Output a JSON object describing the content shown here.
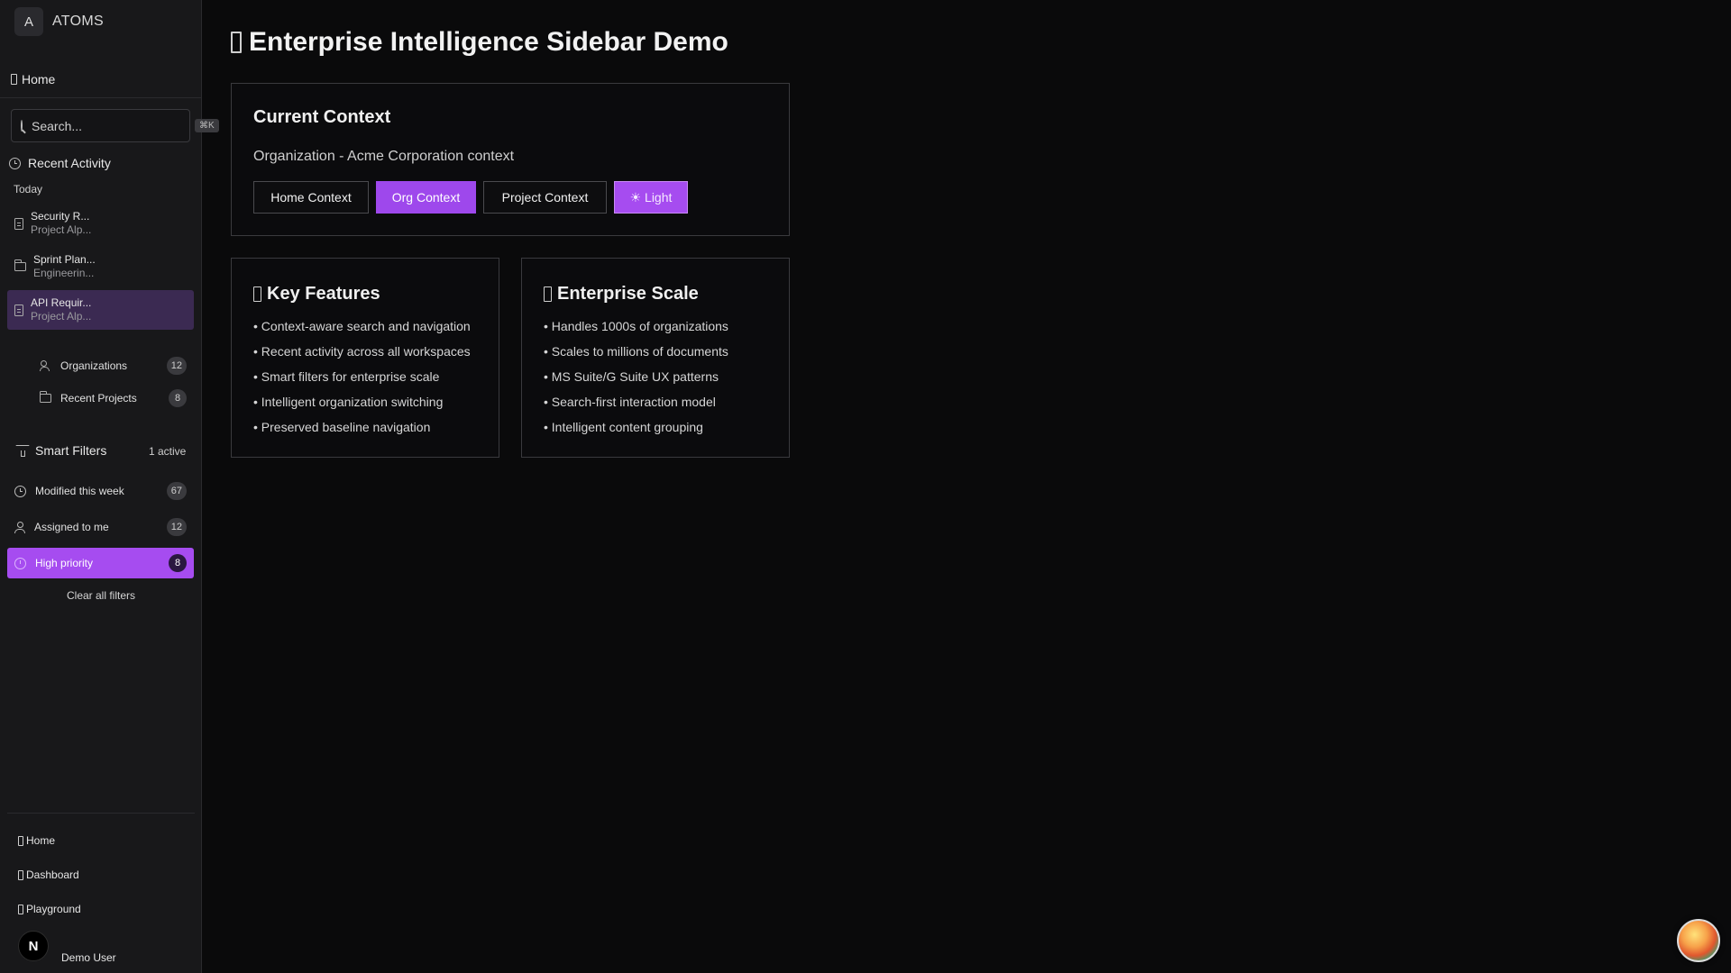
{
  "brand": {
    "initial": "A",
    "name": "ATOMS"
  },
  "nav_top": {
    "home_label": "Home"
  },
  "search": {
    "placeholder": "Search...",
    "shortcut": "⌘K"
  },
  "recent": {
    "title": "Recent Activity",
    "group_label": "Today",
    "items": [
      {
        "title": "Security R...",
        "subtitle": "Project Alp...",
        "icon": "document-icon"
      },
      {
        "title": "Sprint Plan...",
        "subtitle": "Engineerin...",
        "icon": "folder-icon"
      },
      {
        "title": "API Requir...",
        "subtitle": "Project Alp...",
        "icon": "document-icon"
      }
    ]
  },
  "quick_links": [
    {
      "label": "Organizations",
      "count": "12",
      "icon": "users-icon"
    },
    {
      "label": "Recent Projects",
      "count": "8",
      "icon": "folder-icon"
    }
  ],
  "smart_filters": {
    "title": "Smart Filters",
    "active_count": "1 active",
    "items": [
      {
        "label": "Modified this week",
        "count": "67",
        "icon": "clock-icon"
      },
      {
        "label": "Assigned to me",
        "count": "12",
        "icon": "user-icon"
      },
      {
        "label": "High priority",
        "count": "8",
        "icon": "alert-icon"
      }
    ],
    "clear_label": "Clear all filters"
  },
  "bottom_nav": [
    {
      "label": "Home"
    },
    {
      "label": "Dashboard"
    },
    {
      "label": "Playground"
    }
  ],
  "user": {
    "initial": "N",
    "name": "Demo User"
  },
  "main": {
    "title": "Enterprise Intelligence Sidebar Demo",
    "context_card": {
      "title": "Current Context",
      "description": "Organization - Acme Corporation context",
      "buttons": [
        "Home Context",
        "Org Context",
        "Project Context",
        "☀ Light"
      ]
    },
    "features_card": {
      "title": "Key Features",
      "items": [
        "• Context-aware search and navigation",
        "• Recent activity across all workspaces",
        "• Smart filters for enterprise scale",
        "• Intelligent organization switching",
        "• Preserved baseline navigation"
      ]
    },
    "scale_card": {
      "title": "Enterprise Scale",
      "items": [
        "• Handles 1000s of organizations",
        "• Scales to millions of documents",
        "• MS Suite/G Suite UX patterns",
        "• Search-first interaction model",
        "• Intelligent content grouping"
      ]
    }
  },
  "colors": {
    "accent": "#a64cf0",
    "active_recent": "#3b2a52",
    "background": "#0a0a0b",
    "sidebar": "#18181a"
  }
}
